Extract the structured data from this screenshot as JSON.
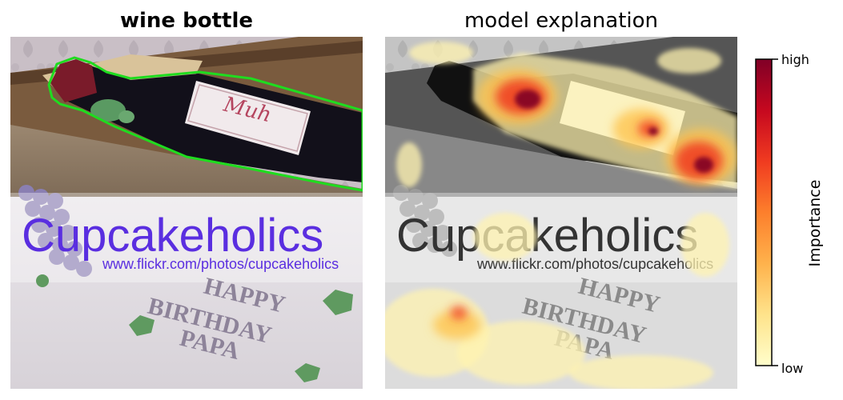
{
  "left_panel": {
    "title": "wine bottle",
    "watermark": {
      "brand": "Cupcakeholics",
      "url": "www.flickr.com/photos/cupcakeholics"
    },
    "bottle_label_script": "Muh",
    "cake_text": [
      "HAPPY",
      "BIRTHDAY",
      "PAPA"
    ]
  },
  "right_panel": {
    "title": "model explanation"
  },
  "colorbar": {
    "high_label": "high",
    "low_label": "low",
    "axis_label": "Importance",
    "colors": [
      "#fffecb",
      "#fee38b",
      "#feb24c",
      "#fd7f2c",
      "#f03b20",
      "#c6081f",
      "#800026"
    ]
  },
  "colors": {
    "segmentation_outline": "#1fdc1f",
    "watermark_text": "#5a2ee0"
  }
}
